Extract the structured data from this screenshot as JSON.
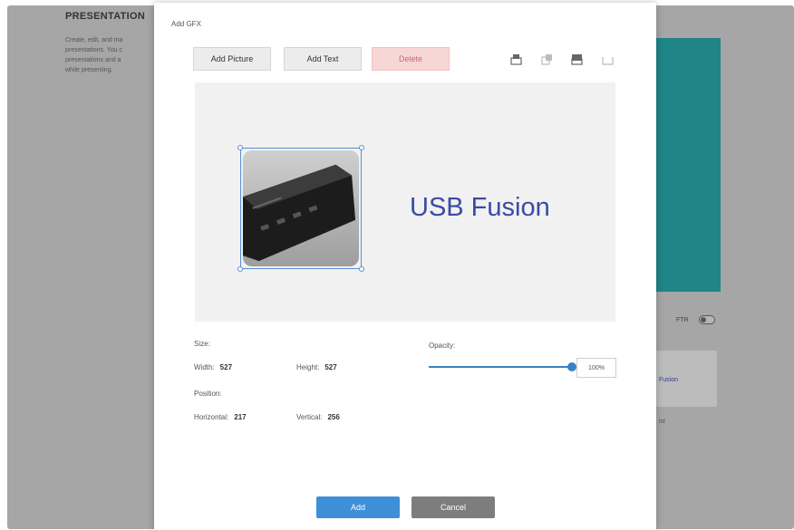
{
  "background": {
    "section_title": "PRESENTATION",
    "description": "Create, edit, and ma\npresentations. You c\npresentations and a\nwhile presenting.",
    "toggle_label": "FTR",
    "card_label": "Fusion",
    "fragment": "ist"
  },
  "modal": {
    "title": "Add GFX",
    "toolbar": {
      "add_picture": "Add Picture",
      "add_text": "Add Text",
      "delete": "Delete"
    },
    "layer_icons": [
      "bring-to-front-icon",
      "bring-forward-icon",
      "send-backward-icon",
      "send-to-back-icon"
    ],
    "canvas_text": "USB Fusion",
    "size": {
      "label": "Size:",
      "width_label": "Width:",
      "width_value": "527",
      "height_label": "Height:",
      "height_value": "527"
    },
    "position": {
      "label": "Position:",
      "horizontal_label": "Horizontal:",
      "horizontal_value": "217",
      "vertical_label": "Vertical:",
      "vertical_value": "256"
    },
    "opacity": {
      "label": "Opacity:",
      "value": 1.0,
      "value_text": "100%"
    },
    "footer": {
      "add": "Add",
      "cancel": "Cancel"
    }
  },
  "colors": {
    "accent": "#3e8fd8",
    "delete_bg": "#f8d6d6",
    "canvas_text": "#3a4ba6",
    "background_preview": "#1f8587"
  }
}
